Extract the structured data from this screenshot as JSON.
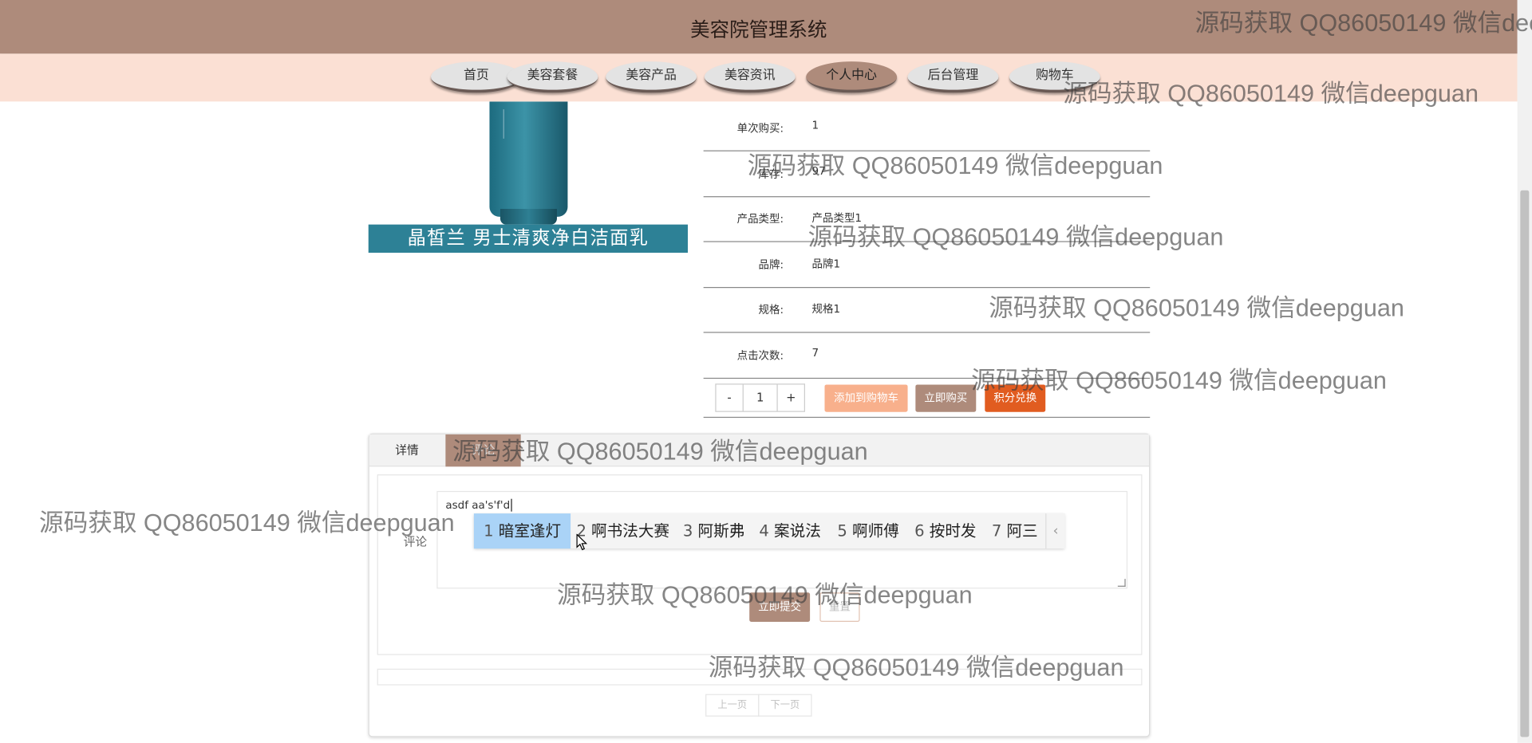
{
  "header": {
    "title": "美容院管理系统"
  },
  "nav": {
    "items": [
      {
        "label": "首页"
      },
      {
        "label": "美容套餐"
      },
      {
        "label": "美容产品"
      },
      {
        "label": "美容资讯"
      },
      {
        "label": "个人中心",
        "active": true
      },
      {
        "label": "后台管理"
      },
      {
        "label": "购物车"
      }
    ]
  },
  "product": {
    "banner_text": "晶皙兰  男士清爽净白洁面乳",
    "details": [
      {
        "label": "单次购买:",
        "value": "1"
      },
      {
        "label": "库存:",
        "value": "97"
      },
      {
        "label": "产品类型:",
        "value": "产品类型1"
      },
      {
        "label": "品牌:",
        "value": "品牌1"
      },
      {
        "label": "规格:",
        "value": "规格1"
      },
      {
        "label": "点击次数:",
        "value": "7"
      }
    ]
  },
  "purchase": {
    "minus_label": "-",
    "quantity": "1",
    "plus_label": "+",
    "add_to_cart_label": "添加到购物车",
    "buy_now_label": "立即购买",
    "points_redeem_label": "积分兑换"
  },
  "tabs": {
    "detail_label": "详情",
    "comment_label": "评论"
  },
  "comment": {
    "label": "评论",
    "input_value": "asdf aa's'f'd",
    "submit_label": "立即提交",
    "reset_label": "重置"
  },
  "pager": {
    "prev_label": "上一页",
    "next_label": "下一页"
  },
  "ime": {
    "candidates": [
      {
        "num": "1",
        "text": "暗室逢灯"
      },
      {
        "num": "2",
        "text": "啊书法大赛"
      },
      {
        "num": "3",
        "text": "阿斯弗"
      },
      {
        "num": "4",
        "text": "案说法"
      },
      {
        "num": "5",
        "text": "啊师傅"
      },
      {
        "num": "6",
        "text": "按时发"
      },
      {
        "num": "7",
        "text": "阿三"
      }
    ],
    "arrow": "‹"
  },
  "watermark": {
    "text": "源码获取 QQ86050149 微信deepguan"
  },
  "colors": {
    "brand": "#ae8b7b",
    "nav_bg": "#fbe0d4",
    "add_to_cart": "#f8b08c",
    "points": "#e15c20",
    "banner": "#2d8196",
    "ime_selected": "#aad3f7"
  }
}
